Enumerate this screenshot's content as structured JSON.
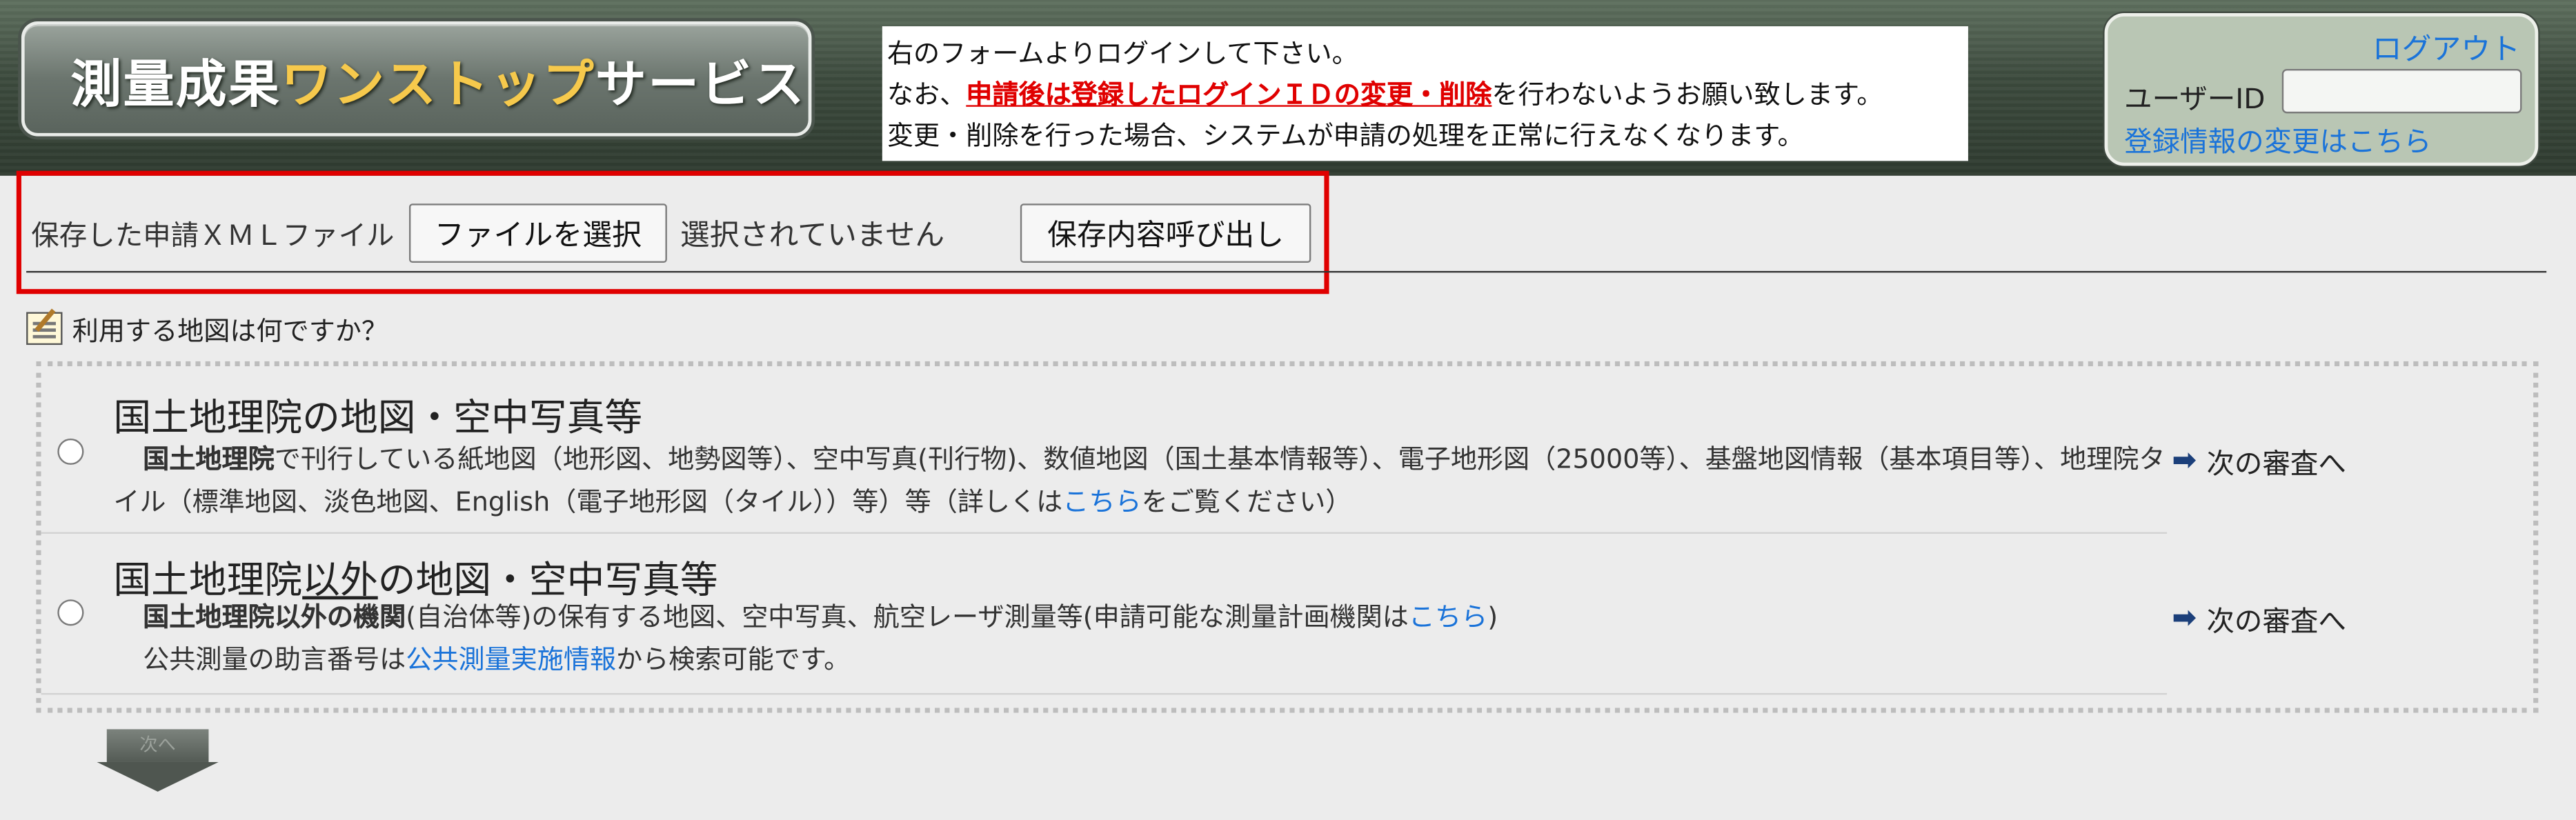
{
  "header": {
    "title_part1": "測量成果",
    "title_part2": "ワンストップ",
    "title_part3": "サービス",
    "notice_line1": "右のフォームよりログインして下さい。",
    "notice_line2_pre": "なお、",
    "notice_line2_red": "申請後は登録したログインＩＤの変更・削除",
    "notice_line2_post": "を行わないようお願い致します。",
    "notice_line3": "変更・削除を行った場合、システムが申請の処理を正常に行えなくなります。"
  },
  "login": {
    "logout": "ログアウト",
    "user_id_label": "ユーザーID",
    "user_id_value": "",
    "change_link": "登録情報の変更はこちら"
  },
  "file_section": {
    "label": "保存した申請ＸＭＬファイル",
    "choose_button": "ファイルを選択",
    "no_file": "選択されていません",
    "load_button": "保存内容呼び出し"
  },
  "question": "利用する地図は何ですか？",
  "options": [
    {
      "title": "国土地理院の地図・空中写真等",
      "desc_bold": "国土地理院",
      "desc_text": "で刊行している紙地図（地形図、地勢図等）、空中写真(刊行物)、数値地図（国土基本情報等）、電子地形図（25000等）、基盤地図情報（基本項目等）、地理院タイル（標準地図、淡色地図、English（電子地形図（タイル））等）等（詳しくは",
      "desc_link": "こちら",
      "desc_text2": "をご覧ください）",
      "next": "次の審査へ"
    },
    {
      "title_pre": "国土地理院",
      "title_ul": "以外",
      "title_post": "の地図・空中写真等",
      "desc_bold": "国土地理院以外の機関",
      "desc_text": "(自治体等)の保有する地図、空中写真、航空レーザ測量等(申請可能な測量計画機関は",
      "desc_link": "こちら",
      "desc_text2": ")",
      "line2_pre": "公共測量の助言番号は",
      "line2_link": "公共測量実施情報",
      "line2_post": "から検索可能です。",
      "next": "次の審査へ"
    }
  ],
  "next_button": "次へ",
  "colors": {
    "accent_red": "#e00000",
    "link_blue": "#1a73d9",
    "title_gold": "#f6c94c"
  }
}
